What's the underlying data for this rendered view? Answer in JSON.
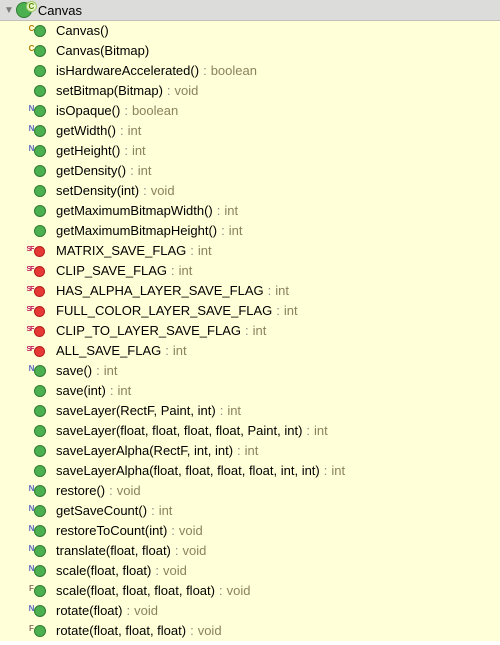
{
  "header": {
    "class_name": "Canvas"
  },
  "members": [
    {
      "badge": "C",
      "kind": "method",
      "sig": "Canvas()",
      "ret": null
    },
    {
      "badge": "C",
      "kind": "method",
      "sig": "Canvas(Bitmap)",
      "ret": null
    },
    {
      "badge": "",
      "kind": "method",
      "sig": "isHardwareAccelerated()",
      "ret": "boolean"
    },
    {
      "badge": "",
      "kind": "method",
      "sig": "setBitmap(Bitmap)",
      "ret": "void"
    },
    {
      "badge": "N",
      "kind": "method",
      "sig": "isOpaque()",
      "ret": "boolean"
    },
    {
      "badge": "N",
      "kind": "method",
      "sig": "getWidth()",
      "ret": "int"
    },
    {
      "badge": "N",
      "kind": "method",
      "sig": "getHeight()",
      "ret": "int"
    },
    {
      "badge": "",
      "kind": "method",
      "sig": "getDensity()",
      "ret": "int"
    },
    {
      "badge": "",
      "kind": "method",
      "sig": "setDensity(int)",
      "ret": "void"
    },
    {
      "badge": "",
      "kind": "method",
      "sig": "getMaximumBitmapWidth()",
      "ret": "int"
    },
    {
      "badge": "",
      "kind": "method",
      "sig": "getMaximumBitmapHeight()",
      "ret": "int"
    },
    {
      "badge": "SF",
      "kind": "field",
      "sig": "MATRIX_SAVE_FLAG",
      "ret": "int"
    },
    {
      "badge": "SF",
      "kind": "field",
      "sig": "CLIP_SAVE_FLAG",
      "ret": "int"
    },
    {
      "badge": "SF",
      "kind": "field",
      "sig": "HAS_ALPHA_LAYER_SAVE_FLAG",
      "ret": "int"
    },
    {
      "badge": "SF",
      "kind": "field",
      "sig": "FULL_COLOR_LAYER_SAVE_FLAG",
      "ret": "int"
    },
    {
      "badge": "SF",
      "kind": "field",
      "sig": "CLIP_TO_LAYER_SAVE_FLAG",
      "ret": "int"
    },
    {
      "badge": "SF",
      "kind": "field",
      "sig": "ALL_SAVE_FLAG",
      "ret": "int"
    },
    {
      "badge": "N",
      "kind": "method",
      "sig": "save()",
      "ret": "int"
    },
    {
      "badge": "",
      "kind": "method",
      "sig": "save(int)",
      "ret": "int"
    },
    {
      "badge": "",
      "kind": "method",
      "sig": "saveLayer(RectF, Paint, int)",
      "ret": "int"
    },
    {
      "badge": "",
      "kind": "method",
      "sig": "saveLayer(float, float, float, float, Paint, int)",
      "ret": "int"
    },
    {
      "badge": "",
      "kind": "method",
      "sig": "saveLayerAlpha(RectF, int, int)",
      "ret": "int"
    },
    {
      "badge": "",
      "kind": "method",
      "sig": "saveLayerAlpha(float, float, float, float, int, int)",
      "ret": "int"
    },
    {
      "badge": "N",
      "kind": "method",
      "sig": "restore()",
      "ret": "void"
    },
    {
      "badge": "N",
      "kind": "method",
      "sig": "getSaveCount()",
      "ret": "int"
    },
    {
      "badge": "N",
      "kind": "method",
      "sig": "restoreToCount(int)",
      "ret": "void"
    },
    {
      "badge": "N",
      "kind": "method",
      "sig": "translate(float, float)",
      "ret": "void"
    },
    {
      "badge": "N",
      "kind": "method",
      "sig": "scale(float, float)",
      "ret": "void"
    },
    {
      "badge": "F",
      "kind": "method",
      "sig": "scale(float, float, float, float)",
      "ret": "void"
    },
    {
      "badge": "N",
      "kind": "method",
      "sig": "rotate(float)",
      "ret": "void"
    },
    {
      "badge": "F",
      "kind": "method",
      "sig": "rotate(float, float, float)",
      "ret": "void"
    }
  ]
}
